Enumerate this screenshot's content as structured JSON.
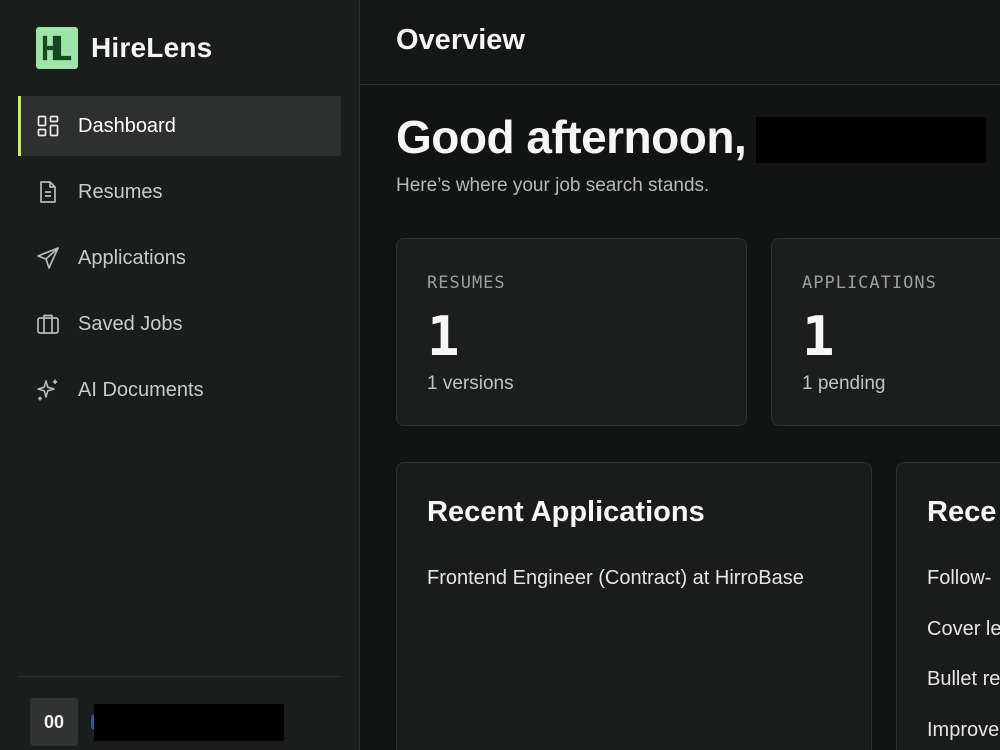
{
  "brand": {
    "logo_text": "HL",
    "name": "HireLens",
    "logo_color": "#9ee3a8"
  },
  "accent": "#c6ef5a",
  "sidebar": {
    "items": [
      {
        "label": "Dashboard",
        "icon": "dashboard-grid-icon",
        "active": true
      },
      {
        "label": "Resumes",
        "icon": "document-icon",
        "active": false
      },
      {
        "label": "Applications",
        "icon": "send-icon",
        "active": false
      },
      {
        "label": "Saved Jobs",
        "icon": "briefcase-icon",
        "active": false
      },
      {
        "label": "AI Documents",
        "icon": "sparkles-icon",
        "active": false
      }
    ],
    "user": {
      "initials": "00"
    }
  },
  "header": {
    "title": "Overview"
  },
  "main": {
    "greeting": "Good afternoon,",
    "subtitle": "Here’s where your job search stands.",
    "stats": [
      {
        "label": "RESUMES",
        "value": "1",
        "sub": "1 versions"
      },
      {
        "label": "APPLICATIONS",
        "value": "1",
        "sub": "1 pending"
      }
    ],
    "recent_applications": {
      "title": "Recent Applications",
      "items": [
        "Frontend Engineer (Contract) at HirroBase"
      ]
    },
    "recent_documents": {
      "title": "Rece",
      "items": [
        "Follow-",
        "Cover le",
        "Bullet re",
        "Improve"
      ]
    }
  }
}
